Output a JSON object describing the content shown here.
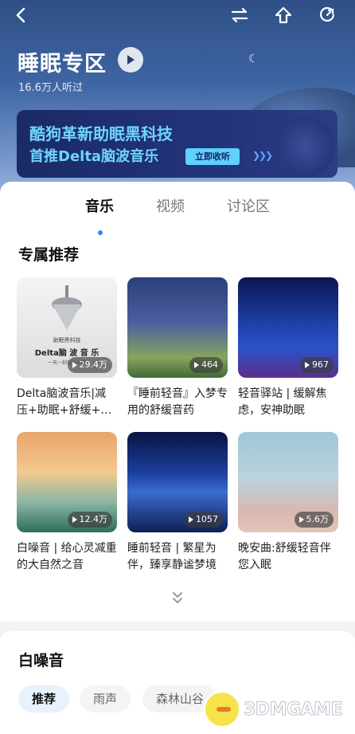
{
  "header": {
    "title": "睡眠专区",
    "listeners": "16.6万人听过",
    "icons": [
      "back-icon",
      "switch-icon",
      "share-icon",
      "refresh-icon",
      "play-icon"
    ]
  },
  "banner": {
    "line1": "酷狗革新助眠黑科技",
    "line2": "首推Delta脑波音乐",
    "cta": "立即收听"
  },
  "tabs": [
    {
      "label": "音乐",
      "active": true
    },
    {
      "label": "视频",
      "active": false
    },
    {
      "label": "讨论区",
      "active": false
    }
  ],
  "section_recommend": {
    "title": "专属推荐",
    "items": [
      {
        "title": "Delta脑波音乐|减压+助眠+舒缓+…",
        "count": "29.4万",
        "cover_text": [
          "助眠黑科技",
          "Delta脑 波 音 乐",
          "一天一刻安心入眠"
        ]
      },
      {
        "title": "『睡前轻音』入梦专用的舒缓音药",
        "count": "464"
      },
      {
        "title": "轻音驿站 | 缓解焦虑，安神助眠",
        "count": "967"
      },
      {
        "title": "白噪音 | 给心灵减重的大自然之音",
        "count": "12.4万"
      },
      {
        "title": "睡前轻音 | 繁星为伴，臻享静谧梦境",
        "count": "1057"
      },
      {
        "title": "晚安曲:舒缓轻音伴您入眠",
        "count": "5.6万"
      }
    ]
  },
  "section_whitenoise": {
    "title": "白噪音",
    "chips": [
      {
        "label": "推荐",
        "active": true
      },
      {
        "label": "雨声",
        "active": false
      },
      {
        "label": "森林山谷",
        "active": false
      }
    ]
  },
  "watermark": "3DMGAME",
  "colors": {
    "accent": "#2c8cf0",
    "banner_text": "#6fd4ff"
  }
}
